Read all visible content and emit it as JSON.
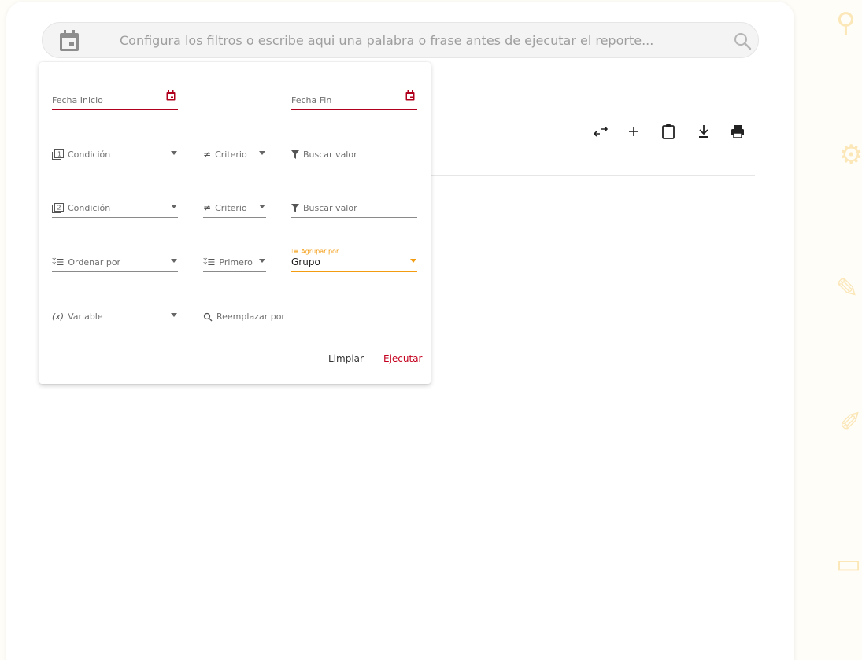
{
  "search": {
    "placeholder": "Configura los filtros o escribe aqui una palabra o frase antes de ejecutar el reporte..."
  },
  "toolbar": {
    "icons": [
      "swap-icon",
      "add-icon",
      "clipboard-icon",
      "download-icon",
      "print-icon"
    ]
  },
  "filters": {
    "fecha_inicio": "Fecha Inicio",
    "fecha_fin": "Fecha Fin",
    "row1": {
      "condicion": "Condición",
      "criterio": "Criterio",
      "buscar": "Buscar valor"
    },
    "row2": {
      "condicion": "Condición",
      "criterio": "Criterio",
      "buscar": "Buscar valor"
    },
    "ordenar": "Ordenar por",
    "primero": "Primero",
    "agrupar_label": "Agrupar por",
    "agrupar_value": "Grupo",
    "variable": "Variable",
    "reemplazar": "Reemplazar por"
  },
  "actions": {
    "limpiar": "Limpiar",
    "ejecutar": "Ejecutar"
  },
  "colors": {
    "accent_red": "#b0001e",
    "accent_orange": "#f39c12"
  }
}
